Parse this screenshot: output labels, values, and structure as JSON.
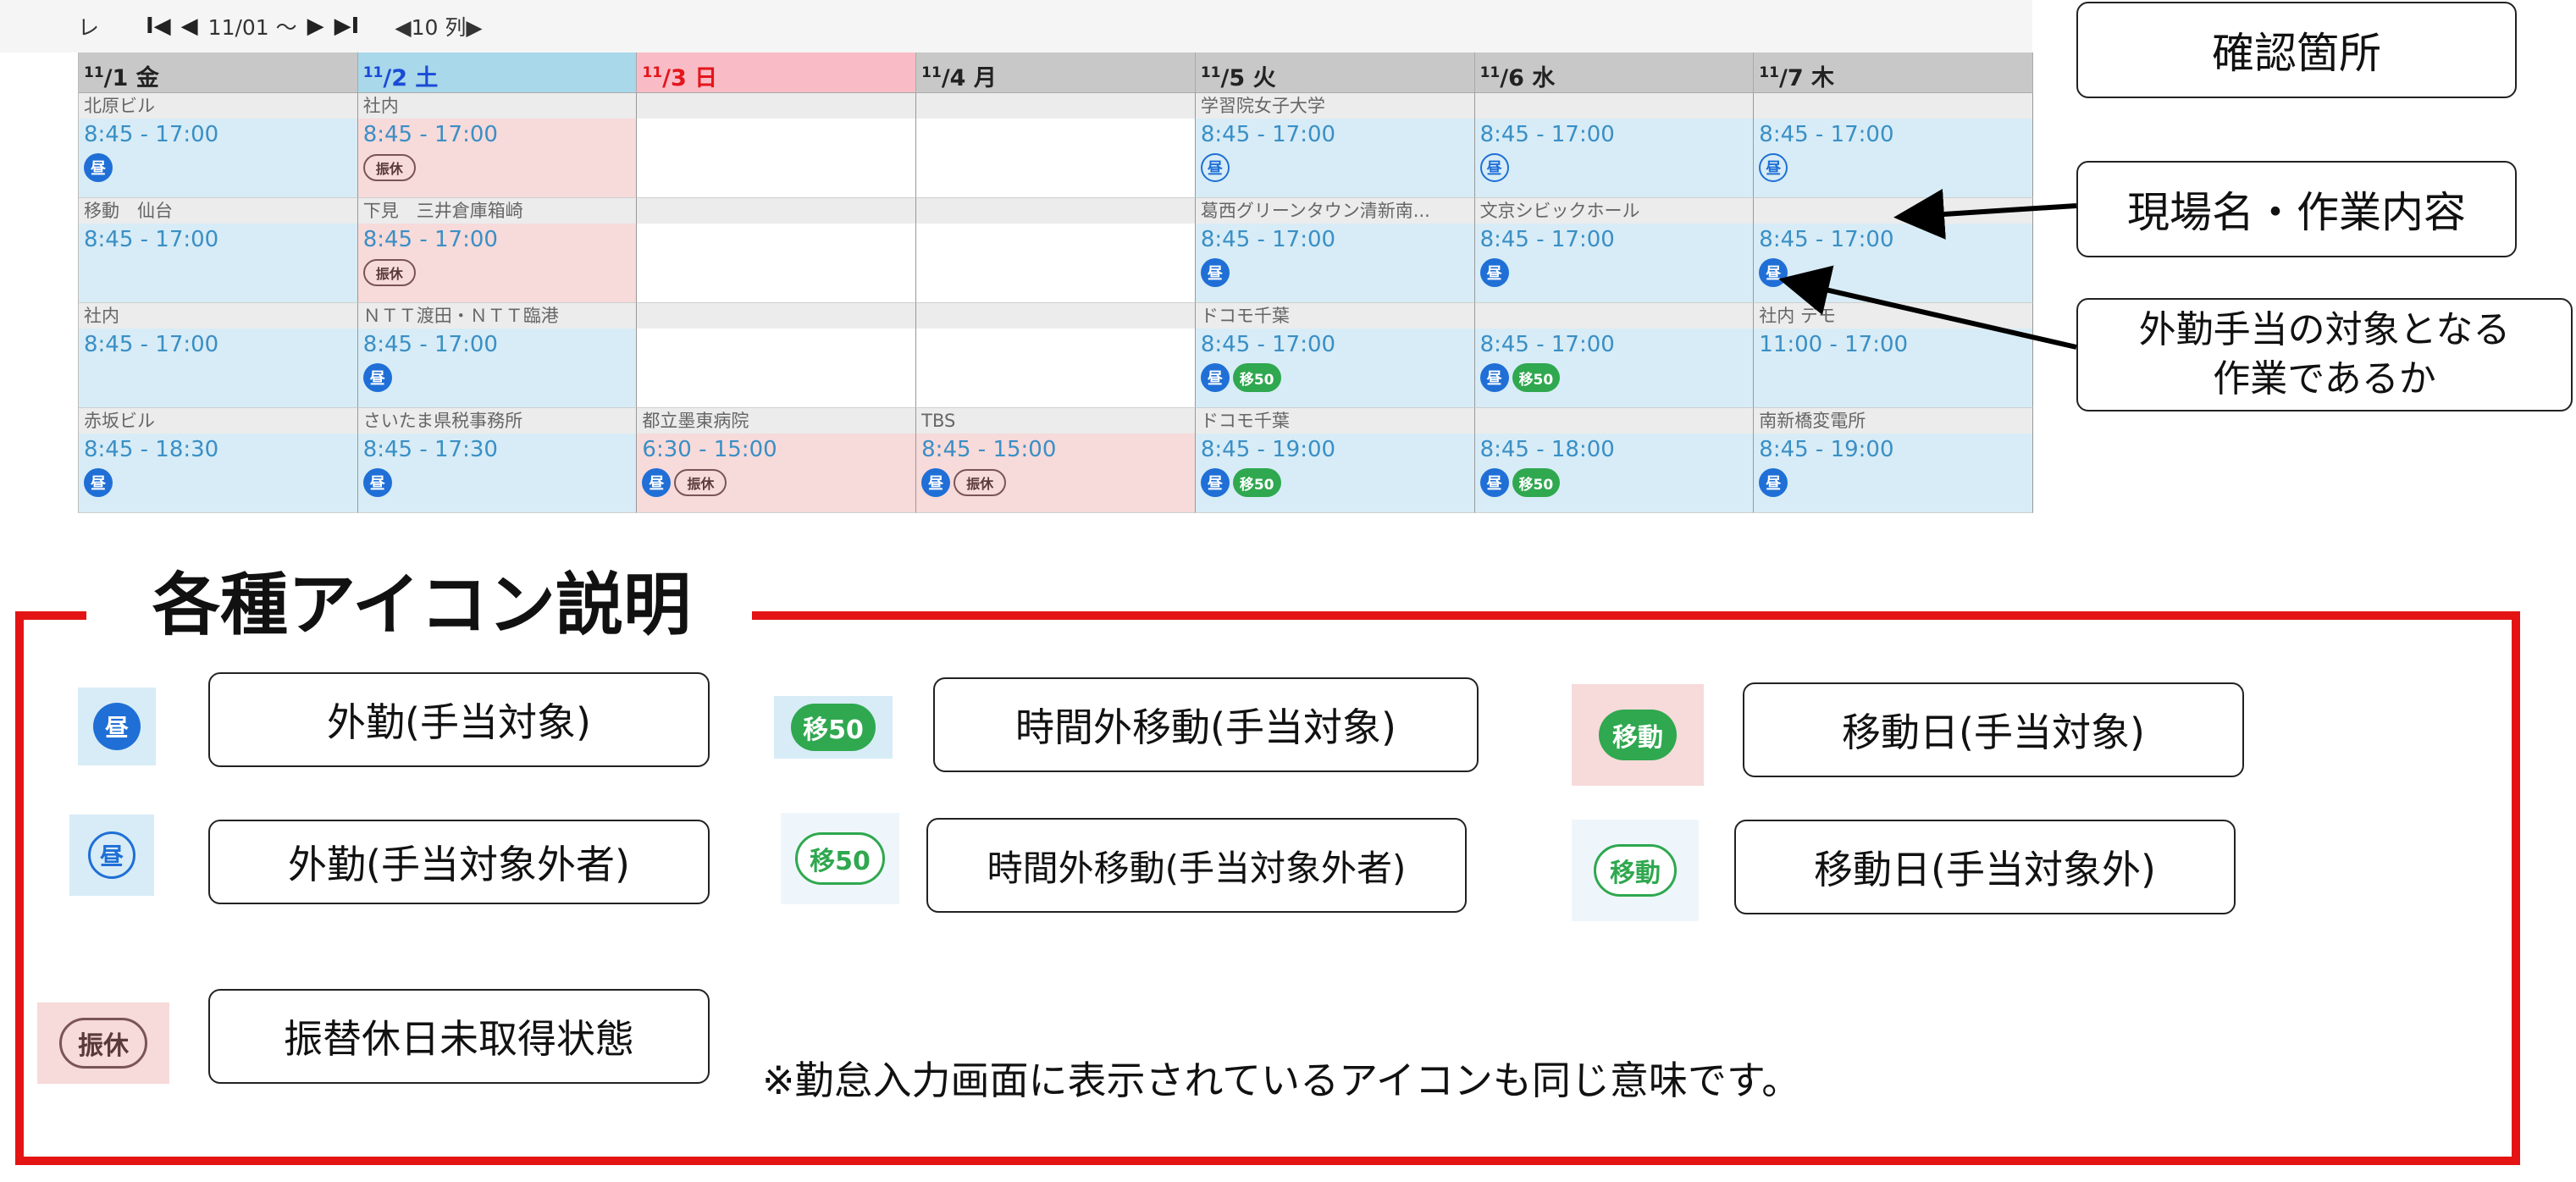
{
  "nav": {
    "lead": "レ",
    "first": "I◀",
    "prev": "◀",
    "range": "11/01 ～",
    "next": "▶",
    "last": "▶I",
    "cols": "◀10 列▶"
  },
  "headers": [
    {
      "md": "11",
      "day": "/1 金",
      "kind": "weekday"
    },
    {
      "md": "11",
      "day": "/2 土",
      "kind": "sat"
    },
    {
      "md": "11",
      "day": "/3 日",
      "kind": "sun"
    },
    {
      "md": "11",
      "day": "/4 月",
      "kind": "weekday"
    },
    {
      "md": "11",
      "day": "/5 火",
      "kind": "weekday"
    },
    {
      "md": "11",
      "day": "/6 水",
      "kind": "weekday"
    },
    {
      "md": "11",
      "day": "/7 木",
      "kind": "weekday"
    }
  ],
  "rows": [
    [
      {
        "site": "北原ビル",
        "time": "8:45 - 17:00",
        "bg": "blue",
        "icons": [
          "hiru"
        ]
      },
      {
        "site": "社内",
        "time": "8:45 - 17:00",
        "bg": "pink",
        "icons": [
          "furi"
        ]
      },
      {
        "site": "",
        "time": "",
        "bg": "white",
        "icons": []
      },
      {
        "site": "",
        "time": "",
        "bg": "white",
        "icons": []
      },
      {
        "site": "学習院女子大学",
        "time": "8:45 - 17:00",
        "bg": "blue",
        "icons": [
          "hiru-o"
        ]
      },
      {
        "site": "",
        "time": "8:45 - 17:00",
        "bg": "blue",
        "icons": [
          "hiru-o"
        ]
      },
      {
        "site": "",
        "time": "8:45 - 17:00",
        "bg": "blue",
        "icons": [
          "hiru-o"
        ]
      }
    ],
    [
      {
        "site": "移動　仙台",
        "time": "8:45 - 17:00",
        "bg": "blue",
        "icons": []
      },
      {
        "site": "下見　三井倉庫箱崎",
        "time": "8:45 - 17:00",
        "bg": "pink",
        "icons": [
          "furi"
        ]
      },
      {
        "site": "",
        "time": "",
        "bg": "white",
        "icons": []
      },
      {
        "site": "",
        "time": "",
        "bg": "white",
        "icons": []
      },
      {
        "site": "葛西グリーンタウン清新南...",
        "time": "8:45 - 17:00",
        "bg": "blue",
        "icons": [
          "hiru"
        ]
      },
      {
        "site": "文京シビックホール",
        "time": "8:45 - 17:00",
        "bg": "blue",
        "icons": [
          "hiru"
        ]
      },
      {
        "site": "",
        "time": "8:45 - 17:00",
        "bg": "blue",
        "icons": [
          "hiru"
        ]
      }
    ],
    [
      {
        "site": "社内",
        "time": "8:45 - 17:00",
        "bg": "blue",
        "icons": []
      },
      {
        "site": "ＮＴＴ渡田・ＮＴＴ臨港",
        "time": "8:45 - 17:00",
        "bg": "blue",
        "icons": [
          "hiru"
        ]
      },
      {
        "site": "",
        "time": "",
        "bg": "white",
        "icons": []
      },
      {
        "site": "",
        "time": "",
        "bg": "white",
        "icons": []
      },
      {
        "site": "ドコモ千葉",
        "time": "8:45 - 17:00",
        "bg": "blue",
        "icons": [
          "hiru",
          "i50"
        ]
      },
      {
        "site": "",
        "time": "8:45 - 17:00",
        "bg": "blue",
        "icons": [
          "hiru",
          "i50"
        ]
      },
      {
        "site": "社内 デモ",
        "time": "11:00 - 17:00",
        "bg": "blue",
        "icons": []
      }
    ],
    [
      {
        "site": "赤坂ビル",
        "time": "8:45 - 18:30",
        "bg": "blue",
        "icons": [
          "hiru"
        ]
      },
      {
        "site": "さいたま県税事務所",
        "time": "8:45 - 17:30",
        "bg": "blue",
        "icons": [
          "hiru"
        ]
      },
      {
        "site": "都立墨東病院",
        "time": "6:30 - 15:00",
        "bg": "pink",
        "icons": [
          "hiru",
          "furi"
        ]
      },
      {
        "site": "TBS",
        "time": "8:45 - 15:00",
        "bg": "pink",
        "icons": [
          "hiru",
          "furi"
        ]
      },
      {
        "site": "ドコモ千葉",
        "time": "8:45 - 19:00",
        "bg": "blue",
        "icons": [
          "hiru",
          "i50"
        ]
      },
      {
        "site": "",
        "time": "8:45 - 18:00",
        "bg": "blue",
        "icons": [
          "hiru",
          "i50"
        ]
      },
      {
        "site": "南新橋変電所",
        "time": "8:45 - 19:00",
        "bg": "blue",
        "icons": [
          "hiru"
        ]
      }
    ]
  ],
  "icon_labels": {
    "hiru": "昼",
    "furi": "振休",
    "i50": "移50",
    "idou": "移動"
  },
  "callouts": {
    "check": "確認箇所",
    "site_work": "現場名・作業内容",
    "allowance_line1": "外勤手当の対象となる",
    "allowance_line2": "作業であるか"
  },
  "legend": {
    "title": "各種アイコン説明",
    "items": {
      "gaikin": "外勤(手当対象)",
      "jikangai": "時間外移動(手当対象)",
      "idoubi": "移動日(手当対象)",
      "gaikin_out": "外勤(手当対象外者)",
      "jikangai_out": "時間外移動(手当対象外者)",
      "idoubi_out": "移動日(手当対象外)",
      "furikae": "振替休日未取得状態"
    },
    "note": "※勤怠入力画面に表示されているアイコンも同じ意味です。"
  },
  "colors": {
    "accent_red": "#e41414",
    "icon_blue": "#1f6fd6",
    "icon_green": "#2fa84f",
    "time_blue": "#3a8fc5"
  }
}
